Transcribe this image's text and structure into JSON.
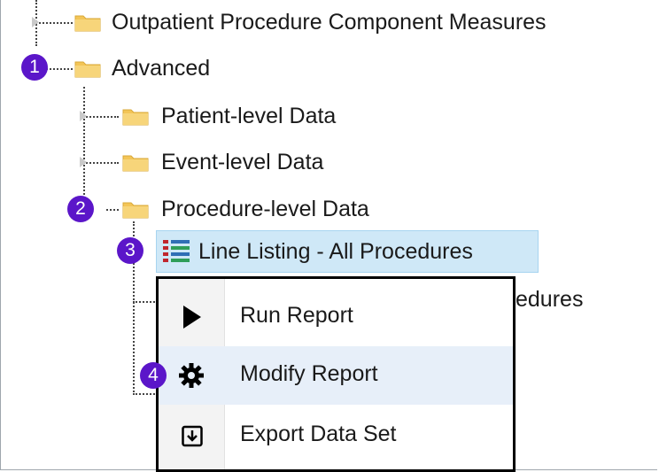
{
  "tree": {
    "items": [
      {
        "label": "Outpatient Procedure Component Measures"
      },
      {
        "label": "Advanced"
      },
      {
        "label": "Patient-level Data"
      },
      {
        "label": "Event-level Data"
      },
      {
        "label": "Procedure-level Data"
      },
      {
        "label": "Line Listing - All Procedures"
      },
      {
        "label_partial": "edures"
      }
    ]
  },
  "badges": [
    "1",
    "2",
    "3",
    "4"
  ],
  "context_menu": {
    "items": [
      {
        "label": "Run Report",
        "icon": "play-icon"
      },
      {
        "label": "Modify Report",
        "icon": "gear-icon"
      },
      {
        "label": "Export Data Set",
        "icon": "export-icon"
      }
    ]
  },
  "colors": {
    "badge": "#5b16c9",
    "selection": "#cfe8f7",
    "folder": "#f3c557"
  }
}
